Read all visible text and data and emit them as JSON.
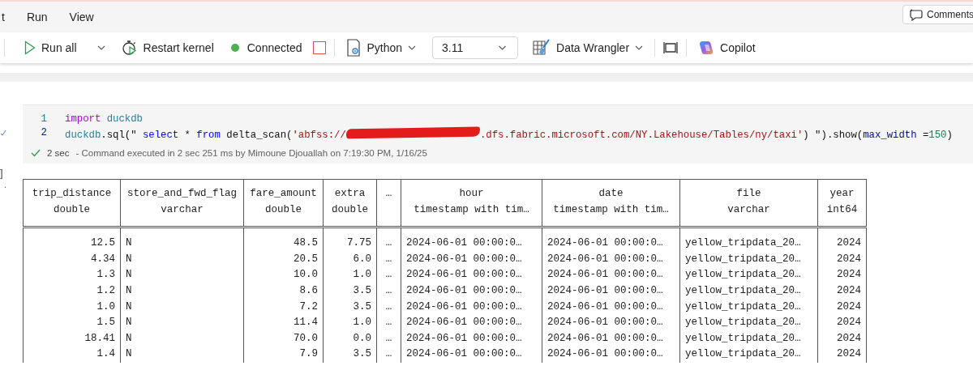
{
  "menu": [
    {
      "label": "t"
    },
    {
      "label": "Run"
    },
    {
      "label": "View"
    }
  ],
  "comments_button": {
    "label": "Comments"
  },
  "toolbar": [
    {
      "kind": "run",
      "label": "Run all",
      "has_menu": true
    },
    {
      "kind": "restart",
      "label": "Restart kernel",
      "has_menu": false
    },
    {
      "kind": "status",
      "label": "Connected",
      "connected": true
    },
    {
      "kind": "stop"
    },
    {
      "kind": "kernel",
      "label": "Python",
      "has_menu": true
    },
    {
      "kind": "version",
      "value": "3.11"
    },
    {
      "kind": "wrangler",
      "label": "Data Wrangler",
      "has_menu": true
    },
    {
      "kind": "frame"
    },
    {
      "kind": "copilot",
      "label": "Copilot",
      "has_menu": false
    }
  ],
  "cell": {
    "gutter_mark": "]",
    "gutter_dot": ".",
    "lines": [
      {
        "number": "1",
        "active": false,
        "tokens": [
          {
            "kind": "keyword",
            "text": "import"
          },
          {
            "kind": "module",
            "text": "duckdb"
          }
        ]
      },
      {
        "number": "2",
        "active": true,
        "tokens": [
          {
            "kind": "module",
            "text": "duckdb"
          },
          {
            "kind": "plain",
            "text": ".sql(\""
          },
          {
            "kind": "sql",
            "text": " select"
          },
          {
            "kind": "plain",
            "text": " * "
          },
          {
            "kind": "sql",
            "text": "from"
          },
          {
            "kind": "plain",
            "text": " delta_scan("
          },
          {
            "kind": "string",
            "text": "'abfss://"
          },
          {
            "kind": "redaction"
          },
          {
            "kind": "string",
            "text": ".dfs.fabric.microsoft.com/NY.Lakehouse/Tables/ny/taxi'"
          },
          {
            "kind": "plain",
            "text": ") \").show("
          },
          {
            "kind": "param",
            "text": "max_width"
          },
          {
            "kind": "plain",
            "text": " ="
          },
          {
            "kind": "number",
            "text": "150"
          },
          {
            "kind": "plain",
            "text": ")"
          }
        ]
      }
    ],
    "status": {
      "succeeded": true,
      "duration": "2 sec",
      "message": "- Command executed in 2 sec 251 ms by Mimoune Djouallah on 7:19:30 PM, 1/16/25"
    }
  },
  "table": {
    "columns": [
      {
        "name": "trip_distance",
        "type": "double",
        "kind": "number"
      },
      {
        "name": "store_and_fwd_flag",
        "type": "varchar",
        "kind": "text"
      },
      {
        "name": "fare_amount",
        "type": "double",
        "kind": "number"
      },
      {
        "name": "extra",
        "type": "double",
        "kind": "number"
      },
      {
        "name": "…",
        "kind": "elided"
      },
      {
        "name": "hour",
        "type": "timestamp with tim…",
        "kind": "text"
      },
      {
        "name": "date",
        "type": "timestamp with tim…",
        "kind": "text"
      },
      {
        "name": "file",
        "type": "varchar",
        "kind": "text"
      },
      {
        "name": "year",
        "type": "int64",
        "kind": "number"
      }
    ],
    "rows": [
      [
        "12.5",
        "N",
        "48.5",
        "7.75",
        "…",
        "2024-06-01 00:00:0…",
        "2024-06-01 00:00:0…",
        "yellow_tripdata_20…",
        "2024"
      ],
      [
        "4.34",
        "N",
        "20.5",
        "6.0",
        "…",
        "2024-06-01 00:00:0…",
        "2024-06-01 00:00:0…",
        "yellow_tripdata_20…",
        "2024"
      ],
      [
        "1.3",
        "N",
        "10.0",
        "1.0",
        "…",
        "2024-06-01 00:00:0…",
        "2024-06-01 00:00:0…",
        "yellow_tripdata_20…",
        "2024"
      ],
      [
        "1.2",
        "N",
        "8.6",
        "3.5",
        "…",
        "2024-06-01 00:00:0…",
        "2024-06-01 00:00:0…",
        "yellow_tripdata_20…",
        "2024"
      ],
      [
        "1.0",
        "N",
        "7.2",
        "3.5",
        "…",
        "2024-06-01 00:00:0…",
        "2024-06-01 00:00:0…",
        "yellow_tripdata_20…",
        "2024"
      ],
      [
        "1.5",
        "N",
        "11.4",
        "1.0",
        "…",
        "2024-06-01 00:00:0…",
        "2024-06-01 00:00:0…",
        "yellow_tripdata_20…",
        "2024"
      ],
      [
        "18.41",
        "N",
        "70.0",
        "0.0",
        "…",
        "2024-06-01 00:00:0…",
        "2024-06-01 00:00:0…",
        "yellow_tripdata_20…",
        "2024"
      ],
      [
        "1.4",
        "N",
        "7.9",
        "3.5",
        "…",
        "2024-06-01 00:00:0…",
        "2024-06-01 00:00:0…",
        "yellow_tripdata_20…",
        "2024"
      ]
    ]
  }
}
